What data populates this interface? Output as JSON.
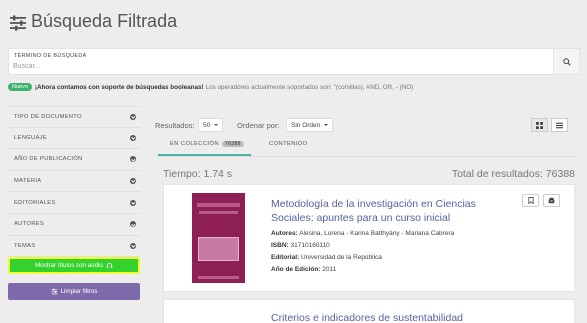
{
  "header": {
    "title": "Búsqueda Filtrada",
    "icon": "sliders-icon"
  },
  "search": {
    "caption": "TÉRMINO DE BÚSQUEDA",
    "placeholder": "Buscar...",
    "button_icon": "search-icon"
  },
  "notice": {
    "badge": "Nuevo",
    "bold": "¡Ahora contamos con soporte de búsquedas booleanas!",
    "text": "Los operadores actualmente soportados son: \"(comillas), AND, OR, - (NO)"
  },
  "filters": {
    "items": [
      {
        "label": "TIPO DE DOCUMENTO"
      },
      {
        "label": "LENGUAJE"
      },
      {
        "label": "AÑO DE PUBLICACIÓN"
      },
      {
        "label": "MATERIA"
      },
      {
        "label": "EDITORIALES"
      },
      {
        "label": "AUTORES"
      },
      {
        "label": "TEMAS"
      }
    ],
    "audio_button": "Mostrar títulos con audio",
    "clear_button": "Limpiar filtros"
  },
  "toolbar": {
    "results_label": "Resultados:",
    "results_value": "50",
    "order_label": "Ordenar por:",
    "order_value": "Sin Orden"
  },
  "tabs": [
    {
      "label": "EN COLECCIÓN",
      "count": "76388",
      "active": true
    },
    {
      "label": "CONTENIDO",
      "active": false
    }
  ],
  "stats": {
    "time": "Tiempo: 1.74 s",
    "total": "Total de resultados: 76388"
  },
  "results": [
    {
      "title": "Metodología de la investigación en Ciencias Sociales: apuntes para un curso inicial",
      "authors_label": "Autores:",
      "authors": "Alesina, Lorena - Karina Batthyány - Mariana Cabrera",
      "isbn_label": "ISBN:",
      "isbn": "31710160110",
      "publisher_label": "Editorial:",
      "publisher": "Universidad de la República",
      "year_label": "Año de Edición:",
      "year": "2011",
      "cover_color": "#8e1f55"
    },
    {
      "title": "Criterios e indicadores de sustentabilidad"
    }
  ],
  "colors": {
    "accent_green": "#35d22e",
    "highlight_yellow": "#f2ff2e",
    "purple": "#7e6aab",
    "link": "#5661a6",
    "tab_underline": "#4db3a4"
  }
}
